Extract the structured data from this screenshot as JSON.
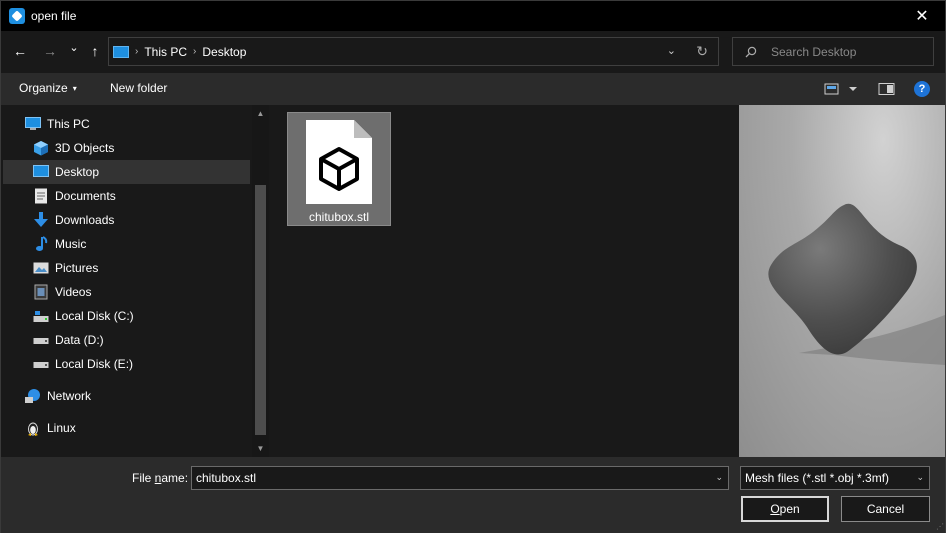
{
  "window": {
    "title": "open file",
    "close_glyph": "✕"
  },
  "nav": {
    "back_glyph": "←",
    "forward_glyph": "→",
    "recent_glyph": "⌄",
    "up_glyph": "↑",
    "breadcrumb": [
      "This PC",
      "Desktop"
    ],
    "crumb_sep": "›",
    "dropdown_glyph": "⌄",
    "refresh_glyph": "↻"
  },
  "search": {
    "placeholder": "Search Desktop"
  },
  "toolbar": {
    "organize_label": "Organize",
    "caret": "▾",
    "new_folder_label": "New folder",
    "help_glyph": "?"
  },
  "sidebar": {
    "items": [
      {
        "label": "This PC",
        "icon": "pc-icon"
      },
      {
        "label": "3D Objects",
        "icon": "3d-objects-icon"
      },
      {
        "label": "Desktop",
        "icon": "desktop-icon",
        "selected": true
      },
      {
        "label": "Documents",
        "icon": "documents-icon"
      },
      {
        "label": "Downloads",
        "icon": "downloads-icon"
      },
      {
        "label": "Music",
        "icon": "music-icon"
      },
      {
        "label": "Pictures",
        "icon": "pictures-icon"
      },
      {
        "label": "Videos",
        "icon": "videos-icon"
      },
      {
        "label": "Local Disk (C:)",
        "icon": "drive-c-icon"
      },
      {
        "label": "Data (D:)",
        "icon": "drive-icon"
      },
      {
        "label": "Local Disk (E:)",
        "icon": "drive-icon"
      },
      {
        "label": "Network",
        "icon": "network-icon"
      },
      {
        "label": "Linux",
        "icon": "linux-icon"
      }
    ],
    "scroll_up": "▲",
    "scroll_down": "▼"
  },
  "files": [
    {
      "name": "chitubox.stl",
      "icon": "3d-model-file-icon",
      "selected": true
    }
  ],
  "bottom": {
    "file_name_label_pre": "File ",
    "file_name_label_underline": "n",
    "file_name_label_post": "ame:",
    "file_name_value": "chitubox.stl",
    "file_type_value": "Mesh files (*.stl *.obj *.3mf)",
    "open_label_underline": "O",
    "open_label_post": "pen",
    "cancel_label": "Cancel",
    "dropdown_glyph": "⌄"
  },
  "colors": {
    "accent": "#1e8fe0",
    "help": "#1e73d6",
    "background": "#191919",
    "toolbar": "#2b2b2b"
  }
}
